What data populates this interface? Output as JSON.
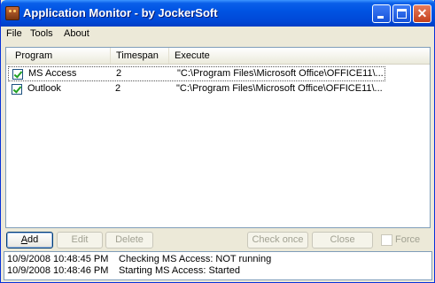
{
  "window": {
    "title": "Application Monitor - by JockerSoft",
    "icon": "app-icon"
  },
  "menu": {
    "items": [
      "File",
      "Tools",
      "About"
    ]
  },
  "list": {
    "columns": [
      "Program",
      "Timespan",
      "Execute"
    ],
    "rows": [
      {
        "checked": true,
        "program": "MS Access",
        "timespan": "2",
        "execute": "\"C:\\Program Files\\Microsoft Office\\OFFICE11\\..."
      },
      {
        "checked": true,
        "program": "Outlook",
        "timespan": "2",
        "execute": "\"C:\\Program Files\\Microsoft Office\\OFFICE11\\..."
      }
    ]
  },
  "buttons": {
    "add_prefix": "A",
    "add_rest": "dd",
    "edit": "Edit",
    "delete": "Delete",
    "check_once": "Check once",
    "close": "Close",
    "force": "Force"
  },
  "log": [
    {
      "time": "10/9/2008 10:48:45 PM",
      "message": "Checking MS Access:   NOT running"
    },
    {
      "time": "10/9/2008 10:48:46 PM",
      "message": "Starting MS Access:   Started"
    }
  ],
  "colors": {
    "titlebar": "#0054e3",
    "check": "#21a121",
    "disabled_text": "#a1a192"
  }
}
